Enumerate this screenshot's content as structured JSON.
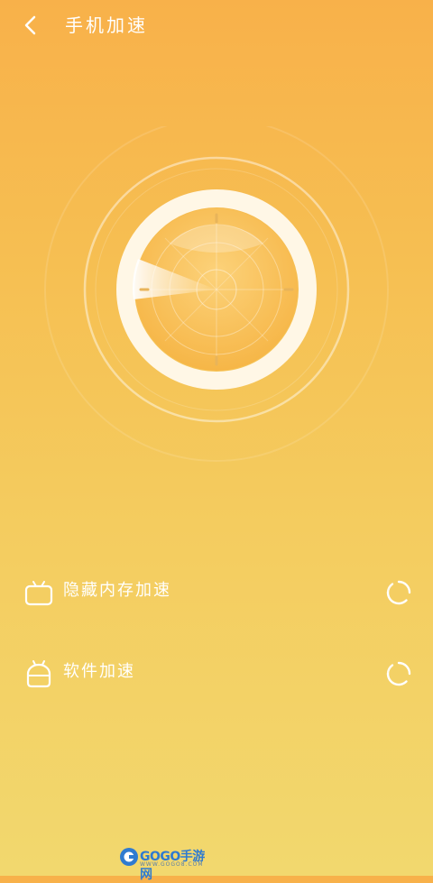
{
  "header": {
    "title": "手机加速",
    "back_icon": "chevron-left-icon"
  },
  "radar": {
    "state": "scanning",
    "ring_color": "#FFF6E3",
    "accent_color": "#F3B04A"
  },
  "items": [
    {
      "label": "隐藏内存加速",
      "icon": "tv-icon",
      "status_icon": "loading-spinner-icon"
    },
    {
      "label": "软件加速",
      "icon": "android-icon",
      "status_icon": "loading-spinner-icon"
    }
  ],
  "watermark": {
    "brand": "GOGO手游网",
    "url": "WWW.GOGO8.COM"
  },
  "colors": {
    "bg_top": "#F8B14A",
    "bg_bottom": "#F2D86E",
    "text": "#FFFFFF",
    "logo_blue": "#2F7BD0"
  }
}
